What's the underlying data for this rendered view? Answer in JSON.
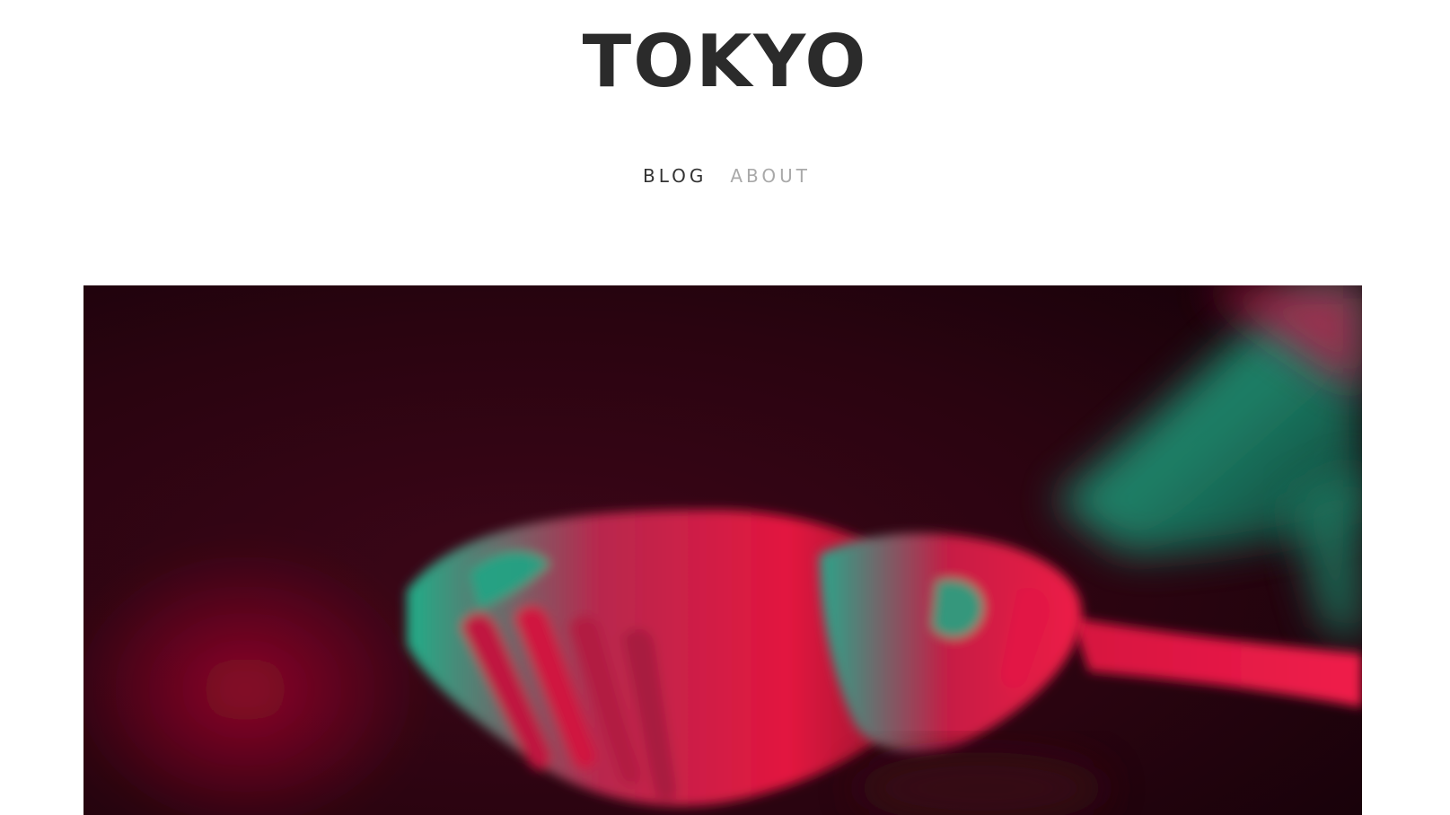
{
  "header": {
    "site_title": "TOKYO"
  },
  "nav": {
    "items": [
      {
        "label": "BLOG",
        "active": true
      },
      {
        "label": "ABOUT",
        "active": false
      }
    ]
  },
  "hero": {
    "subject": "two cupped hands lit with red and teal neon light",
    "colors": {
      "background": "#2a0410",
      "red_light": "#e8163e",
      "teal_light": "#16a882"
    }
  }
}
